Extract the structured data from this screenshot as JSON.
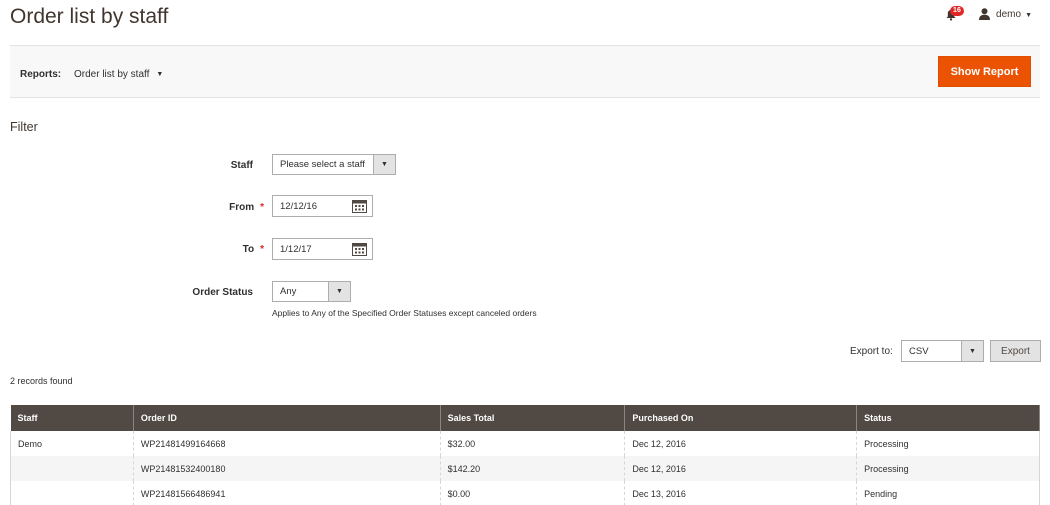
{
  "header": {
    "title": "Order list by staff",
    "notification_count": "16",
    "user_name": "demo"
  },
  "reports_bar": {
    "label": "Reports:",
    "selected_report": "Order list by staff",
    "show_report_label": "Show Report"
  },
  "filter": {
    "title": "Filter",
    "staff": {
      "label": "Staff",
      "value": "Please select a staff"
    },
    "from": {
      "label": "From",
      "required_mark": "*",
      "value": "12/12/16"
    },
    "to": {
      "label": "To",
      "required_mark": "*",
      "value": "1/12/17"
    },
    "order_status": {
      "label": "Order Status",
      "value": "Any",
      "note": "Applies to Any of the Specified Order Statuses except canceled orders"
    }
  },
  "export": {
    "label": "Export to:",
    "format": "CSV",
    "button_label": "Export"
  },
  "records_found": "2 records found",
  "table": {
    "columns": [
      "Staff",
      "Order ID",
      "Sales Total",
      "Purchased On",
      "Status"
    ],
    "rows": [
      [
        "Demo",
        "WP21481499164668",
        "$32.00",
        "Dec 12, 2016",
        "Processing"
      ],
      [
        "",
        "WP21481532400180",
        "$142.20",
        "Dec 12, 2016",
        "Processing"
      ],
      [
        "",
        "WP21481566486941",
        "$0.00",
        "Dec 13, 2016",
        "Pending"
      ]
    ]
  },
  "colors": {
    "accent": "#eb5202",
    "table_header": "#514943",
    "required": "#e22626"
  }
}
